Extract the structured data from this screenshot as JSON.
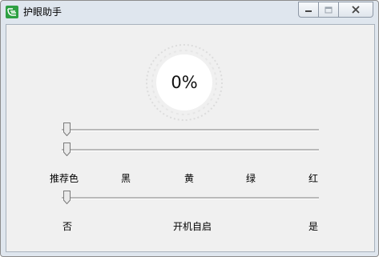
{
  "window": {
    "title": "护眼助手",
    "icon": "app-logo-icon",
    "controls": [
      "minimize-icon",
      "maximize-icon",
      "close-icon"
    ],
    "accent": "#2ea043"
  },
  "dial": {
    "value_text": "0%",
    "value": 0
  },
  "sliders": [
    {
      "name": "brightness",
      "value": 0
    },
    {
      "name": "color",
      "value": 0
    },
    {
      "name": "autostart",
      "value": 0
    }
  ],
  "color_labels": [
    "推荐色",
    "黑",
    "黄",
    "绿",
    "红"
  ],
  "autostart": {
    "no_label": "否",
    "title": "开机自启",
    "yes_label": "是"
  }
}
